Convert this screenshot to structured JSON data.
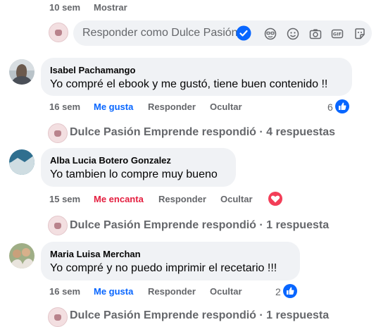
{
  "top_actions": {
    "time": "10 sem",
    "show": "Mostrar"
  },
  "reply_box": {
    "placeholder": "Responder como Dulce Pasión"
  },
  "comments": [
    {
      "author": "Isabel Pachamango",
      "text": "Yo compré el ebook y me gustó, tiene buen contenido !!",
      "time": "16 sem",
      "reaction_label": "Me gusta",
      "reply": "Responder",
      "hide": "Ocultar",
      "reaction_count": "6",
      "page_reply": "Dulce Pasión Emprende respondió · 4 respuestas"
    },
    {
      "author": "Alba Lucia Botero Gonzalez",
      "text": "Yo tambien lo compre muy bueno",
      "time": "15 sem",
      "reaction_label": "Me encanta",
      "reply": "Responder",
      "hide": "Ocultar",
      "reaction_count": "",
      "page_reply": "Dulce Pasión Emprende respondió · 1 respuesta"
    },
    {
      "author": "Maria Luisa Merchan",
      "text": "Yo compré y no puedo imprimir el recetario !!!",
      "time": "16 sem",
      "reaction_label": "Me gusta",
      "reply": "Responder",
      "hide": "Ocultar",
      "reaction_count": "2",
      "page_reply": "Dulce Pasión Emprende respondió · 1 respuesta"
    }
  ],
  "colors": {
    "like_blue": "#0866ff",
    "love_red": "#e41e3f",
    "muted": "#65676b",
    "bubble": "#f0f2f5"
  }
}
